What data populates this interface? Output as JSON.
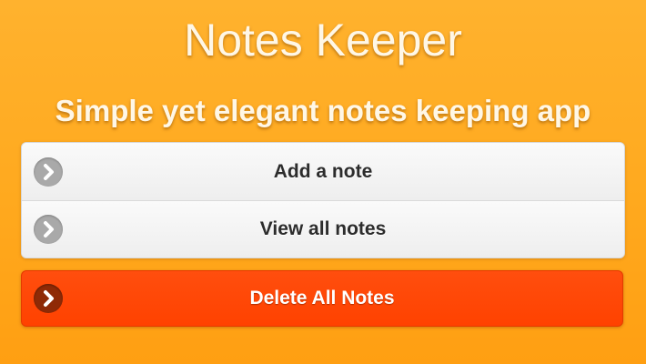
{
  "header": {
    "title": "Notes Keeper",
    "subtitle": "Simple yet elegant notes keeping app"
  },
  "menu": {
    "items": [
      {
        "label": "Add a note",
        "icon": "chevron-right-icon"
      },
      {
        "label": "View all notes",
        "icon": "chevron-right-icon"
      }
    ]
  },
  "danger_action": {
    "label": "Delete All Notes",
    "icon": "chevron-right-icon",
    "color": "#ff4500"
  },
  "colors": {
    "background": "#ffad22",
    "title_text": "#fff7e6",
    "list_background": "#f4f4f4",
    "list_text": "#2c2c2c",
    "icon_gray": "#a9a9a9",
    "danger": "#ff4500"
  }
}
